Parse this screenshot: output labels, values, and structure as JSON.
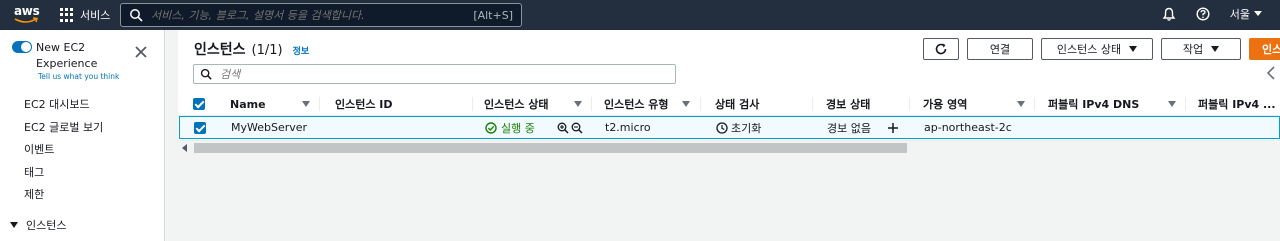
{
  "topnav": {
    "logo_text": "aws",
    "services_label": "서비스",
    "search_placeholder": "서비스, 기능, 블로그, 설명서 등을 검색합니다.",
    "search_shortcut": "[Alt+S]",
    "region_label": "서울",
    "icons": [
      "bell-icon",
      "help-icon",
      "chevron-down-icon"
    ]
  },
  "sidebar": {
    "toggle_label": "New EC2 Experience",
    "toggle_on": true,
    "tell_us": "Tell us what you think",
    "items": [
      {
        "label": "EC2 대시보드"
      },
      {
        "label": "EC2 글로벌 보기"
      },
      {
        "label": "이벤트"
      },
      {
        "label": "태그"
      },
      {
        "label": "제한"
      }
    ],
    "section_label": "인스턴스"
  },
  "main": {
    "title": "인스턴스",
    "count": "(1/1)",
    "info_link": "정보",
    "buttons": {
      "connect": "연결",
      "instance_state": "인스턴스 상태",
      "actions": "작업",
      "launch": "인스턴스 시"
    },
    "filter_placeholder": "검색"
  },
  "table": {
    "columns": [
      "Name",
      "인스턴스 ID",
      "인스턴스 상태",
      "인스턴스 유형",
      "상태 검사",
      "경보 상태",
      "가용 영역",
      "퍼블릭 IPv4 DNS",
      "퍼블릭 IPv4 ..."
    ],
    "rows": [
      {
        "name": "MyWebServer",
        "instance_id": "",
        "state": "실행 중",
        "type": "t2.micro",
        "status_check": "초기화",
        "alarm": "경보 없음",
        "az": "ap-northeast-2c",
        "public_dns": "",
        "public_ip": "",
        "selected": true
      }
    ]
  },
  "colors": {
    "nav_bg": "#232f3e",
    "accent": "#0073bb",
    "primary_button": "#ec7211",
    "running_green": "#1d8102",
    "selected_row": "#f1faff"
  }
}
